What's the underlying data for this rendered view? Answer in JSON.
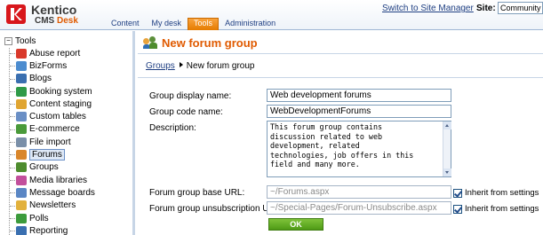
{
  "header": {
    "logo_word": "Kentico",
    "logo_sub_main": "CMS",
    "logo_sub_accent": "Desk",
    "switch_link": "Switch to Site Manager",
    "site_label": "Site:",
    "site_value": "Community",
    "tabs": [
      {
        "label": "Content",
        "active": false
      },
      {
        "label": "My desk",
        "active": false
      },
      {
        "label": "Tools",
        "active": true
      },
      {
        "label": "Administration",
        "active": false
      }
    ],
    "colors": {
      "brand_orange": "#e05a00",
      "logo_red": "#d8171c",
      "link_blue": "#1f3f82"
    }
  },
  "tree": {
    "root_expand": "−",
    "root_label": "Tools",
    "items": [
      {
        "label": "Abuse report",
        "icon": "abuse-report-icon",
        "color": "#d9392b"
      },
      {
        "label": "BizForms",
        "icon": "bizforms-icon",
        "color": "#4c8ccf"
      },
      {
        "label": "Blogs",
        "icon": "blogs-icon",
        "color": "#3a6fb0"
      },
      {
        "label": "Booking system",
        "icon": "booking-system-icon",
        "color": "#2f9a48"
      },
      {
        "label": "Content staging",
        "icon": "content-staging-icon",
        "color": "#e0a531"
      },
      {
        "label": "Custom tables",
        "icon": "custom-tables-icon",
        "color": "#6a8fc5"
      },
      {
        "label": "E-commerce",
        "icon": "ecommerce-icon",
        "color": "#4a9a3a"
      },
      {
        "label": "File import",
        "icon": "file-import-icon",
        "color": "#7a8fa8"
      },
      {
        "label": "Forums",
        "icon": "forums-icon",
        "color": "#d9862b",
        "selected": true
      },
      {
        "label": "Groups",
        "icon": "groups-icon",
        "color": "#4e8c2e"
      },
      {
        "label": "Media libraries",
        "icon": "media-libraries-icon",
        "color": "#c24f9c"
      },
      {
        "label": "Message boards",
        "icon": "message-boards-icon",
        "color": "#5a86c4"
      },
      {
        "label": "Newsletters",
        "icon": "newsletters-icon",
        "color": "#e2b13c"
      },
      {
        "label": "Polls",
        "icon": "polls-icon",
        "color": "#3c9b3c"
      },
      {
        "label": "Reporting",
        "icon": "reporting-icon",
        "color": "#3a6fb0"
      }
    ]
  },
  "page": {
    "title": "New forum group",
    "title_icon": "forum-group-icon",
    "breadcrumb_link": "Groups",
    "breadcrumb_current": "New forum group"
  },
  "form": {
    "display_name_label": "Group display name:",
    "display_name_value": "Web development forums",
    "code_name_label": "Group code name:",
    "code_name_value": "WebDevelopmentForums",
    "description_label": "Description:",
    "description_value": "This forum group contains\ndiscussion related to web\ndevelopment, related\ntechnologies, job offers in this\nfield and many more.",
    "base_url_label": "Forum group base URL:",
    "base_url_value": "~/Forums.aspx",
    "unsub_url_label": "Forum group unsubscription URL:",
    "unsub_url_value": "~/Special-Pages/Forum-Unsubscribe.aspx",
    "inherit_label": "Inherit from settings",
    "inherit_base_checked": true,
    "inherit_unsub_checked": true,
    "ok_label": "OK"
  }
}
